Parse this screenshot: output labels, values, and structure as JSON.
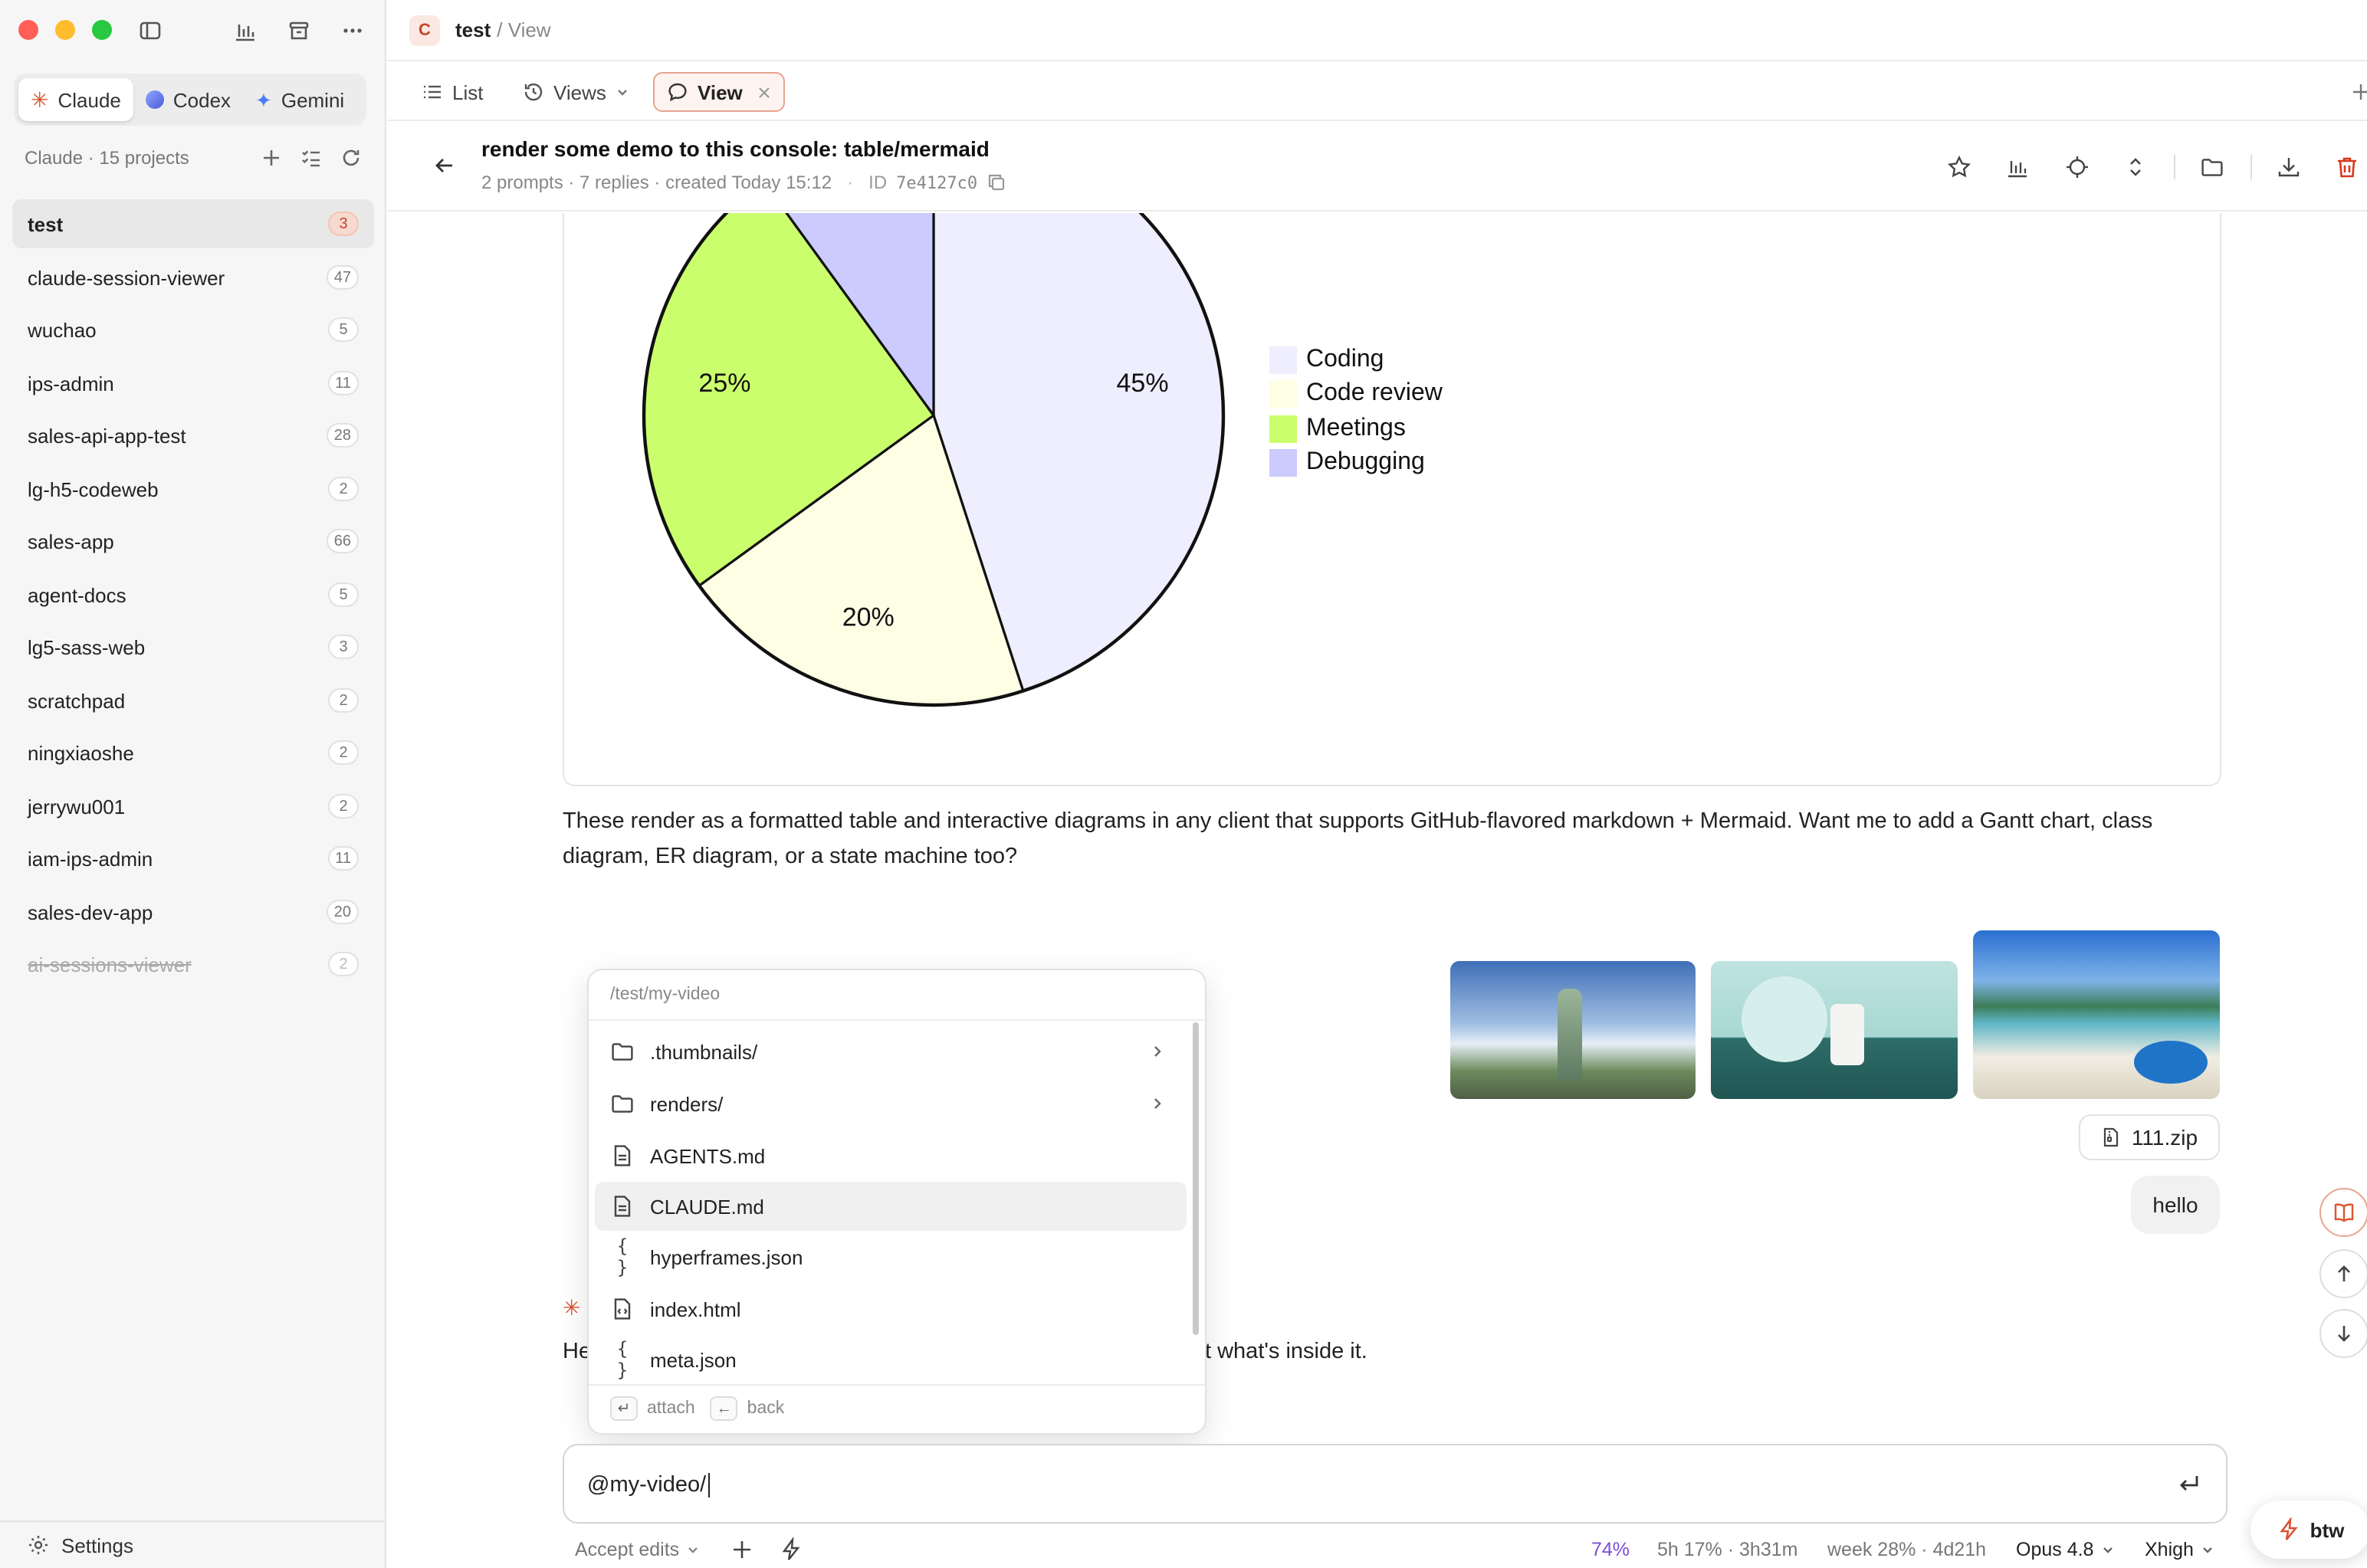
{
  "colors": {
    "accent": "#d9552f",
    "close": "#ff5f57",
    "minimize": "#febc2e",
    "maximize": "#28c840",
    "usage_link": "#7b4fd6",
    "delete": "#d7371b"
  },
  "sidebar": {
    "providers": [
      {
        "label": "Claude",
        "icon": "claude-burst-icon"
      },
      {
        "label": "Codex",
        "icon": "codex-icon"
      },
      {
        "label": "Gemini",
        "icon": "gemini-sparkle-icon"
      }
    ],
    "projects_header": "Claude · 15 projects",
    "projects": [
      {
        "label": "test",
        "count": "3"
      },
      {
        "label": "claude-session-viewer",
        "count": "47"
      },
      {
        "label": "wuchao",
        "count": "5"
      },
      {
        "label": "ips-admin",
        "count": "11"
      },
      {
        "label": "sales-api-app-test",
        "count": "28"
      },
      {
        "label": "lg-h5-codeweb",
        "count": "2"
      },
      {
        "label": "sales-app",
        "count": "66"
      },
      {
        "label": "agent-docs",
        "count": "5"
      },
      {
        "label": "lg5-sass-web",
        "count": "3"
      },
      {
        "label": "scratchpad",
        "count": "2"
      },
      {
        "label": "ningxiaoshe",
        "count": "2"
      },
      {
        "label": "jerrywu001",
        "count": "2"
      },
      {
        "label": "iam-ips-admin",
        "count": "11"
      },
      {
        "label": "sales-dev-app",
        "count": "20"
      },
      {
        "label": "ai-sessions-viewer",
        "count": "2"
      }
    ],
    "settings_label": "Settings"
  },
  "topbar": {
    "avatar": "C",
    "project": "test",
    "crumb": "/ View"
  },
  "viewbar": {
    "list": "List",
    "views": "Views",
    "view": "View"
  },
  "session": {
    "title": "render some demo to this console: table/mermaid",
    "meta": "2 prompts · 7 replies · created Today 15:12",
    "id_label": "ID",
    "id": "7e4127c0"
  },
  "chart_data": {
    "type": "pie",
    "categories": [
      "Coding",
      "Code review",
      "Meetings",
      "Debugging"
    ],
    "values": [
      45,
      20,
      25,
      10
    ],
    "labels": [
      "45%",
      "20%",
      "25%",
      ""
    ],
    "colors": [
      "#eeeefe",
      "#fdfee4",
      "#cbfe6d",
      "#cbcbfe"
    ],
    "legend_position": "right"
  },
  "message": {
    "text": "These render as a formatted table and interactive diagrams in any client that supports GitHub-flavored markdown + Mermaid. Want me to add a Gantt chart, class diagram, ER diagram, or a state machine too?",
    "attachment": "111.zip",
    "user_text": "hello",
    "reply_start": "He",
    "reply_end": "t what's inside it."
  },
  "popup": {
    "path": "/test/my-video",
    "items": [
      {
        "name": ".thumbnails/",
        "type": "folder"
      },
      {
        "name": "renders/",
        "type": "folder"
      },
      {
        "name": "AGENTS.md",
        "type": "file"
      },
      {
        "name": "CLAUDE.md",
        "type": "file"
      },
      {
        "name": "hyperframes.json",
        "type": "json"
      },
      {
        "name": "index.html",
        "type": "html"
      },
      {
        "name": "meta.json",
        "type": "json"
      }
    ],
    "hint_attach": "attach",
    "hint_back": "back"
  },
  "composer": {
    "value": "@my-video/"
  },
  "status": {
    "mode": "Accept edits",
    "context": "74%",
    "session_usage": "5h 17% · 3h31m",
    "week_usage": "week 28% · 4d21h",
    "model": "Opus 4.8",
    "effort": "Xhigh"
  },
  "btw_label": "btw"
}
